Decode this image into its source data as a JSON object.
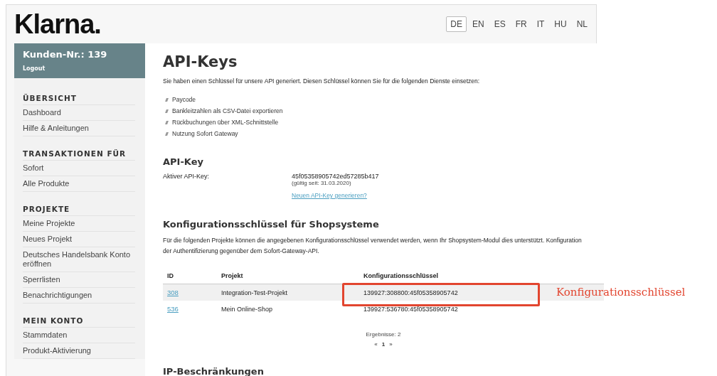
{
  "logo": "Klarna.",
  "languages": [
    {
      "label": "DE",
      "selected": true
    },
    {
      "label": "EN",
      "selected": false
    },
    {
      "label": "ES",
      "selected": false
    },
    {
      "label": "FR",
      "selected": false
    },
    {
      "label": "IT",
      "selected": false
    },
    {
      "label": "HU",
      "selected": false
    },
    {
      "label": "NL",
      "selected": false
    }
  ],
  "sidebar": {
    "customer": "Kunden-Nr.: 139",
    "logout": "Logout",
    "sections": [
      {
        "title": "ÜBERSICHT",
        "items": [
          "Dashboard",
          "Hilfe & Anleitungen"
        ]
      },
      {
        "title": "TRANSAKTIONEN FÜR",
        "items": [
          "Sofort",
          "Alle Produkte"
        ]
      },
      {
        "title": "PROJEKTE",
        "items": [
          "Meine Projekte",
          "Neues Projekt",
          "Deutsches Handelsbank Konto eröffnen",
          "Sperrlisten",
          "Benachrichtigungen"
        ]
      },
      {
        "title": "MEIN KONTO",
        "items": [
          "Stammdaten",
          "Produkt-Aktivierung"
        ]
      }
    ]
  },
  "page_title": "API-Keys",
  "intro": "Sie haben einen Schlüssel für unsere API generiert. Diesen Schlüssel können Sie für die folgenden Dienste einsetzen:",
  "services": [
    "Paycode",
    "Bankleitzahlen als CSV-Datei exportieren",
    "Rückbuchungen über XML-Schnittstelle",
    "Nutzung Sofort Gateway"
  ],
  "api_key": {
    "title": "API-Key",
    "label": "Aktiver API-Key:",
    "value": "45f05358905742ed57285b417",
    "valid": "(gültig seit: 31.03.2020)",
    "link": "Neuen API-Key generieren?"
  },
  "config": {
    "title": "Konfigurationsschlüssel für Shopsysteme",
    "text": "Für die folgenden Projekte können die angegebenen Konfigurationsschlüssel verwendet werden, wenn Ihr Shopsystem-Modul dies unterstützt. Konfiguration der Authentifizierung gegenüber dem Sofort-Gateway-API.",
    "columns": [
      "ID",
      "Projekt",
      "Konfigurationsschlüssel"
    ],
    "rows": [
      {
        "id": "308",
        "project": "Integration-Test-Projekt",
        "key": "139927:308800:45f05358905742",
        "highlighted": true
      },
      {
        "id": "536",
        "project": "Mein Online-Shop",
        "key": "139927:536780:45f05358905742",
        "highlighted": false
      }
    ],
    "results": "Ergebnisse: 2",
    "pager": {
      "prev": "«",
      "page": "1",
      "next": "»"
    }
  },
  "next_section": "IP-Beschränkungen",
  "annotation": "Konfigurationsschlüssel"
}
